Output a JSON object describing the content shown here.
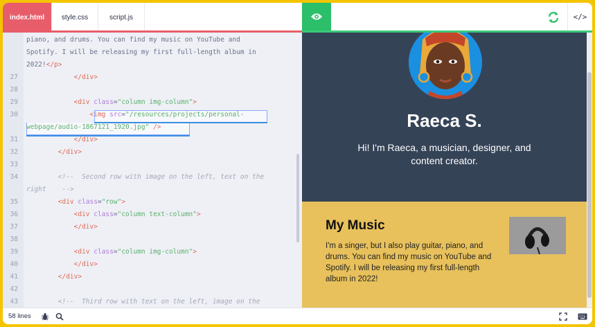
{
  "tabs": [
    "index.html",
    "style.css",
    "script.js"
  ],
  "editor": {
    "lines": [
      {
        "n": "",
        "parts": [
          [
            "plain",
            "piano, and drums. You can find my music on YouTube and"
          ]
        ]
      },
      {
        "n": "",
        "parts": [
          [
            "plain",
            "Spotify. I will be releasing my first full-length album in"
          ]
        ]
      },
      {
        "n": "",
        "parts": [
          [
            "plain",
            "2022!"
          ],
          [
            "tag",
            "</p>"
          ]
        ]
      },
      {
        "n": "27",
        "parts": [
          [
            "plain",
            "            "
          ],
          [
            "tag",
            "</div>"
          ]
        ]
      },
      {
        "n": "28",
        "parts": []
      },
      {
        "n": "29",
        "parts": [
          [
            "plain",
            "            "
          ],
          [
            "tag",
            "<div "
          ],
          [
            "attr",
            "class"
          ],
          [
            "plain",
            "="
          ],
          [
            "str",
            "\"column img-column\""
          ],
          [
            "tag",
            ">"
          ]
        ]
      },
      {
        "n": "30",
        "parts": [
          [
            "plain",
            "                "
          ],
          [
            "tag",
            "<img "
          ],
          [
            "attr",
            "src"
          ],
          [
            "plain",
            "="
          ],
          [
            "str",
            "\"/resources/projects/personal-"
          ]
        ]
      },
      {
        "n": "",
        "parts": [
          [
            "str",
            "webpage/audio-1867121_1920.jpg\""
          ],
          [
            "plain",
            " "
          ],
          [
            "tag",
            "/>"
          ]
        ]
      },
      {
        "n": "31",
        "parts": [
          [
            "plain",
            "            "
          ],
          [
            "tag",
            "</div>"
          ]
        ]
      },
      {
        "n": "32",
        "parts": [
          [
            "plain",
            "        "
          ],
          [
            "tag",
            "</div>"
          ]
        ]
      },
      {
        "n": "33",
        "parts": []
      },
      {
        "n": "34",
        "parts": [
          [
            "plain",
            "        "
          ],
          [
            "cmt",
            "<!--  Second row with image on the left, text on the"
          ]
        ]
      },
      {
        "n": "",
        "parts": [
          [
            "cmt",
            "right    -->"
          ]
        ]
      },
      {
        "n": "35",
        "parts": [
          [
            "plain",
            "        "
          ],
          [
            "tag",
            "<div "
          ],
          [
            "attr",
            "class"
          ],
          [
            "plain",
            "="
          ],
          [
            "str",
            "\"row\""
          ],
          [
            "tag",
            ">"
          ]
        ]
      },
      {
        "n": "36",
        "parts": [
          [
            "plain",
            "            "
          ],
          [
            "tag",
            "<div "
          ],
          [
            "attr",
            "class"
          ],
          [
            "plain",
            "="
          ],
          [
            "str",
            "\"column text-column\""
          ],
          [
            "tag",
            ">"
          ]
        ]
      },
      {
        "n": "37",
        "parts": [
          [
            "plain",
            "            "
          ],
          [
            "tag",
            "</div>"
          ]
        ]
      },
      {
        "n": "38",
        "parts": []
      },
      {
        "n": "39",
        "parts": [
          [
            "plain",
            "            "
          ],
          [
            "tag",
            "<div "
          ],
          [
            "attr",
            "class"
          ],
          [
            "plain",
            "="
          ],
          [
            "str",
            "\"column img-column\""
          ],
          [
            "tag",
            ">"
          ]
        ]
      },
      {
        "n": "40",
        "parts": [
          [
            "plain",
            "            "
          ],
          [
            "tag",
            "</div>"
          ]
        ]
      },
      {
        "n": "41",
        "parts": [
          [
            "plain",
            "        "
          ],
          [
            "tag",
            "</div>"
          ]
        ]
      },
      {
        "n": "42",
        "parts": []
      },
      {
        "n": "43",
        "parts": [
          [
            "plain",
            "        "
          ],
          [
            "cmt",
            "<!--  Third row with text on the left, image on the"
          ]
        ]
      }
    ]
  },
  "preview": {
    "name": "Raeca S.",
    "bio": "Hi! I'm Raeca, a musician, designer, and content creator.",
    "music_title": "My Music",
    "music_text": "I'm a singer, but I also play guitar, piano, and drums. You can find my music on YouTube and Spotify. I will be releasing my first full-length album in 2022!"
  },
  "footer": {
    "lines_count": "58 lines"
  },
  "icons": {
    "preview": "eye-icon",
    "refresh": "refresh-icon",
    "code": "code-icon",
    "debug": "bug-icon",
    "search": "search-icon",
    "fullscreen": "expand-icon",
    "keyboard": "keyboard-icon"
  },
  "colors": {
    "accent_red": "#e85d6a",
    "accent_green": "#2bbf6a",
    "hero_bg": "#354357",
    "music_bg": "#e8c15c",
    "frame_yellow": "#f5c400"
  }
}
